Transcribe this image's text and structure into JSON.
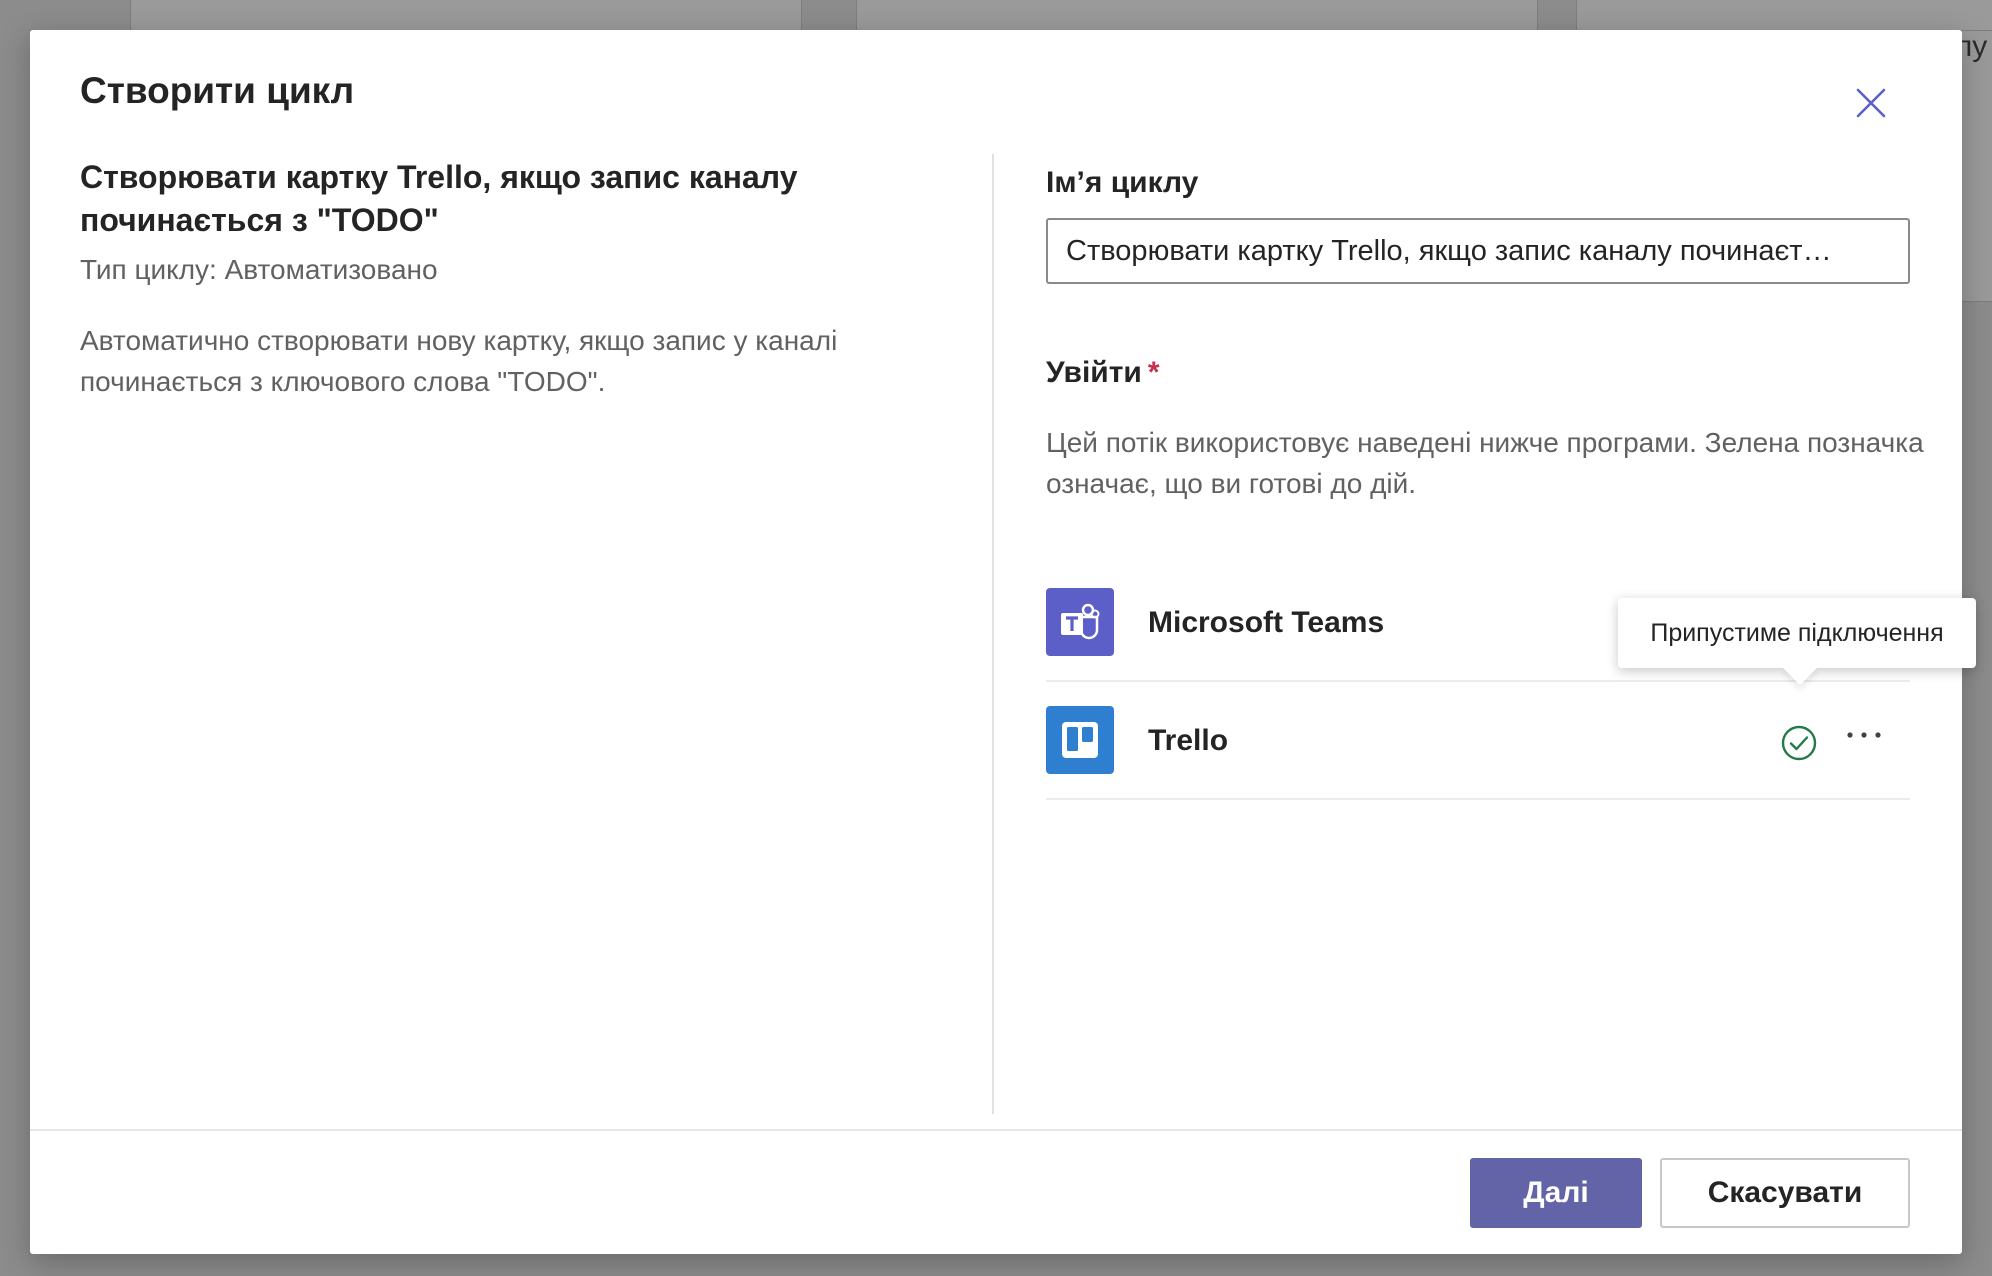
{
  "dialog": {
    "title": "Створити цикл",
    "close_icon": "close-icon"
  },
  "flow": {
    "title": "Створювати картку Trello, якщо запис каналу починається з \"TODO\"",
    "type_text": "Тип циклу: Автоматизовано",
    "description": "Автоматично створювати нову картку, якщо запис у каналі починається з ключового слова \"TODO\"."
  },
  "form": {
    "name_label": "Ім’я циклу",
    "name_value": "Створювати картку Trello, якщо запис каналу починаєт…",
    "signin_label": "Увійти",
    "required_marker": "*",
    "signin_description": "Цей потік використовує наведені нижче програми. Зелена позначка означає, що ви готові до дій."
  },
  "apps": [
    {
      "name": "Microsoft Teams",
      "icon": "teams-logo-icon",
      "status_icon": "check-circle-icon",
      "more_icon": "more-icon",
      "color": "#5b5fc7"
    },
    {
      "name": "Trello",
      "icon": "trello-logo-icon",
      "status_icon": "check-circle-icon",
      "more_icon": "more-icon",
      "color": "#2f7fd1"
    }
  ],
  "tooltip": {
    "text": "Припустиме підключення"
  },
  "footer": {
    "next_label": "Далі",
    "cancel_label": "Скасувати"
  },
  "background": {
    "partial_text": "пу"
  },
  "colors": {
    "accent": "#6264a7",
    "success": "#237b4b",
    "required": "#c4314b"
  }
}
